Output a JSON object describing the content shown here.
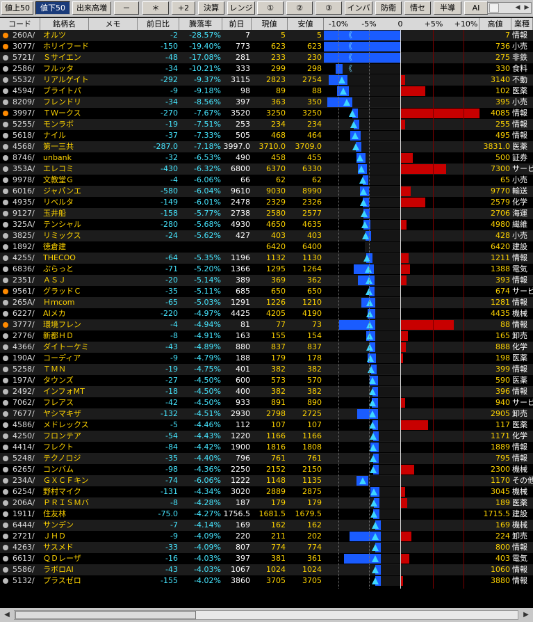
{
  "toolbar": {
    "buttons": [
      {
        "label": "値上50",
        "active": false
      },
      {
        "label": "値下50",
        "active": true
      },
      {
        "label": "出来高増",
        "active": false
      },
      {
        "label": "－",
        "active": false
      },
      {
        "label": "＊",
        "active": false
      },
      {
        "label": "+2",
        "active": false
      },
      {
        "label": "決算",
        "active": false
      },
      {
        "label": "レンジ",
        "active": false
      },
      {
        "label": "①",
        "active": false
      },
      {
        "label": "②",
        "active": false
      },
      {
        "label": "③",
        "active": false
      },
      {
        "label": "インバ",
        "active": false
      },
      {
        "label": "防衛",
        "active": false
      },
      {
        "label": "情セ",
        "active": false
      },
      {
        "label": "半導",
        "active": false
      },
      {
        "label": "AI",
        "active": false
      },
      {
        "label": "少",
        "active": false
      }
    ]
  },
  "header": {
    "code": "コード",
    "name": "銘柄名",
    "memo": "メモ",
    "chg": "前日比",
    "pct": "騰落率",
    "prev": "前日",
    "cur": "現値",
    "low": "安値",
    "scale": [
      "-10%",
      "-5%",
      "0",
      "+5%",
      "+10%"
    ],
    "high": "高値",
    "sector": "業種"
  },
  "colors": {
    "accent_blue": "#1a5cff",
    "red": "#c80000",
    "yellow_text": "#ffd400",
    "cyan_text": "#46e6ff"
  },
  "rows": [
    {
      "dot": "orange",
      "code": "260A/",
      "name": "オルツ",
      "chg": "-2",
      "pct": "-28.57%",
      "prev": "7",
      "cur": "5",
      "low": "5",
      "high": "7",
      "sector": "情報",
      "range": [
        -28.6,
        0
      ],
      "cur_pct": -28.6,
      "chev": true
    },
    {
      "dot": "orange",
      "code": "3077/",
      "name": "ホリイフード",
      "chg": "-150",
      "pct": "-19.40%",
      "prev": "773",
      "cur": "623",
      "low": "623",
      "high": "736",
      "sector": "小売",
      "range": [
        -19.4,
        -4.8
      ],
      "cur_pct": -19.4,
      "chev": true
    },
    {
      "dot": "gray",
      "code": "5721/",
      "name": "Ｓサイエン",
      "chg": "-48",
      "pct": "-17.08%",
      "prev": "281",
      "cur": "233",
      "low": "230",
      "high": "275",
      "sector": "非鉄",
      "range": [
        -18.1,
        -2.1
      ],
      "cur_pct": -17.1,
      "chev": true
    },
    {
      "dot": "gray",
      "code": "2586/",
      "name": "フルッタ",
      "chg": "-34",
      "pct": "-10.21%",
      "prev": "333",
      "cur": "299",
      "low": "298",
      "high": "330",
      "sector": "食料",
      "range": [
        -10.5,
        -0.9
      ],
      "cur_pct": -10.2,
      "chev": true
    },
    {
      "dot": "gray",
      "code": "5532/",
      "name": "リアルゲイト",
      "chg": "-292",
      "pct": "-9.37%",
      "prev": "3115",
      "cur": "2823",
      "low": "2754",
      "high": "3140",
      "sector": "不動",
      "range": [
        -11.6,
        0.8
      ],
      "cur_pct": -9.4,
      "chev": false
    },
    {
      "dot": "gray",
      "code": "4594/",
      "name": "ブライトパ",
      "chg": "-9",
      "pct": "-9.18%",
      "prev": "98",
      "cur": "89",
      "low": "88",
      "high": "102",
      "sector": "医薬",
      "range": [
        -10.2,
        4.1
      ],
      "cur_pct": -9.2,
      "chev": false
    },
    {
      "dot": "gray",
      "code": "8209/",
      "name": "フレンドリ",
      "chg": "-34",
      "pct": "-8.56%",
      "prev": "397",
      "cur": "363",
      "low": "350",
      "high": "395",
      "sector": "小売",
      "range": [
        -11.8,
        -0.5
      ],
      "cur_pct": -8.6,
      "chev": false
    },
    {
      "dot": "orange",
      "code": "3997/",
      "name": "ＴＷークス",
      "chg": "-270",
      "pct": "-7.67%",
      "prev": "3520",
      "cur": "3250",
      "low": "3250",
      "high": "4085",
      "sector": "情報",
      "range": [
        -7.7,
        16.1
      ],
      "cur_pct": -7.7,
      "chev": false
    },
    {
      "dot": "gray",
      "code": "5255/",
      "name": "モンラボ",
      "chg": "-19",
      "pct": "-7.51%",
      "prev": "253",
      "cur": "234",
      "low": "234",
      "high": "255",
      "sector": "情報",
      "range": [
        -7.5,
        0.8
      ],
      "cur_pct": -7.5,
      "chev": false
    },
    {
      "dot": "gray",
      "code": "5618/",
      "name": "ナイル",
      "chg": "-37",
      "pct": "-7.33%",
      "prev": "505",
      "cur": "468",
      "low": "464",
      "high": "495",
      "sector": "情報",
      "range": [
        -8.1,
        -2.0
      ],
      "cur_pct": -7.3,
      "chev": false
    },
    {
      "dot": "gray",
      "code": "4568/",
      "name": "第一三共",
      "chg": "-287.0",
      "pct": "-7.18%",
      "prev": "3997.0",
      "cur": "3710.0",
      "low": "3709.0",
      "high": "3831.0",
      "sector": "医薬",
      "range": [
        -7.2,
        -4.2
      ],
      "cur_pct": -7.2,
      "chev": false
    },
    {
      "dot": "gray",
      "code": "8746/",
      "name": "unbank",
      "chg": "-32",
      "pct": "-6.53%",
      "prev": "490",
      "cur": "458",
      "low": "455",
      "high": "500",
      "sector": "証券",
      "range": [
        -7.1,
        2.0
      ],
      "cur_pct": -6.5,
      "chev": false
    },
    {
      "dot": "gray",
      "code": "353A/",
      "name": "エレコミ",
      "chg": "-430",
      "pct": "-6.32%",
      "prev": "6800",
      "cur": "6370",
      "low": "6330",
      "high": "7300",
      "sector": "サービ",
      "range": [
        -6.9,
        7.4
      ],
      "cur_pct": -6.3,
      "chev": false
    },
    {
      "dot": "gray",
      "code": "9978/",
      "name": "文教堂Ｇ",
      "chg": "-4",
      "pct": "-6.06%",
      "prev": "66",
      "cur": "62",
      "low": "62",
      "high": "65",
      "sector": "小売",
      "range": [
        -6.1,
        -1.5
      ],
      "cur_pct": -6.1,
      "chev": false
    },
    {
      "dot": "gray",
      "code": "6016/",
      "name": "ジャパンエ",
      "chg": "-580",
      "pct": "-6.04%",
      "prev": "9610",
      "cur": "9030",
      "low": "8990",
      "high": "9770",
      "sector": "輸送",
      "range": [
        -6.5,
        1.7
      ],
      "cur_pct": -6.0,
      "chev": false
    },
    {
      "dot": "gray",
      "code": "4935/",
      "name": "リベルタ",
      "chg": "-149",
      "pct": "-6.01%",
      "prev": "2478",
      "cur": "2329",
      "low": "2326",
      "high": "2579",
      "sector": "化学",
      "range": [
        -6.1,
        4.1
      ],
      "cur_pct": -6.0,
      "chev": false
    },
    {
      "dot": "gray",
      "code": "9127/",
      "name": "玉井船",
      "chg": "-158",
      "pct": "-5.77%",
      "prev": "2738",
      "cur": "2580",
      "low": "2577",
      "high": "2706",
      "sector": "海運",
      "range": [
        -5.9,
        -1.2
      ],
      "cur_pct": -5.8,
      "chev": false
    },
    {
      "dot": "gray",
      "code": "325A/",
      "name": "テンシャル",
      "chg": "-280",
      "pct": "-5.68%",
      "prev": "4930",
      "cur": "4650",
      "low": "4635",
      "high": "4980",
      "sector": "繊維",
      "range": [
        -6.0,
        1.0
      ],
      "cur_pct": -5.7,
      "chev": false
    },
    {
      "dot": "gray",
      "code": "3825/",
      "name": "リミックス",
      "chg": "-24",
      "pct": "-5.62%",
      "prev": "427",
      "cur": "403",
      "low": "403",
      "high": "428",
      "sector": "小売",
      "range": [
        -5.6,
        0.2
      ],
      "cur_pct": -5.6,
      "chev": false
    },
    {
      "dot": "gray",
      "code": "1892/",
      "name": "徳倉建",
      "chg": "",
      "pct": "",
      "prev": "",
      "cur": "6420",
      "low": "6400",
      "high": "6420",
      "sector": "建設",
      "range": [
        -5.7,
        0
      ],
      "cur_pct": -5.5,
      "chev": false,
      "noBlue": true
    },
    {
      "dot": "gray",
      "code": "4255/",
      "name": "THECOO",
      "chg": "-64",
      "pct": "-5.35%",
      "prev": "1196",
      "cur": "1132",
      "low": "1130",
      "high": "1211",
      "sector": "情報",
      "range": [
        -5.5,
        1.3
      ],
      "cur_pct": -5.4,
      "chev": false
    },
    {
      "dot": "gray",
      "code": "6836/",
      "name": "ぷらっと",
      "chg": "-71",
      "pct": "-5.20%",
      "prev": "1366",
      "cur": "1295",
      "low": "1264",
      "high": "1388",
      "sector": "電気",
      "range": [
        -7.5,
        1.6
      ],
      "cur_pct": -5.2,
      "chev": false
    },
    {
      "dot": "gray",
      "code": "2351/",
      "name": "ＡＳＪ",
      "chg": "-20",
      "pct": "-5.14%",
      "prev": "389",
      "cur": "369",
      "low": "362",
      "high": "393",
      "sector": "情報",
      "range": [
        -6.9,
        1.0
      ],
      "cur_pct": -5.1,
      "chev": false
    },
    {
      "dot": "orange",
      "code": "9561/",
      "name": "グラッドＣ",
      "chg": "-35",
      "pct": "-5.11%",
      "prev": "685",
      "cur": "650",
      "low": "650",
      "high": "674",
      "sector": "サービ",
      "range": [
        -5.1,
        -1.6
      ],
      "cur_pct": -5.1,
      "chev": false
    },
    {
      "dot": "gray",
      "code": "265A/",
      "name": "Ｈｍcom",
      "chg": "-65",
      "pct": "-5.03%",
      "prev": "1291",
      "cur": "1226",
      "low": "1210",
      "high": "1281",
      "sector": "情報",
      "range": [
        -6.3,
        -0.8
      ],
      "cur_pct": -5.0,
      "chev": false
    },
    {
      "dot": "gray",
      "code": "6227/",
      "name": "AIメカ",
      "chg": "-220",
      "pct": "-4.97%",
      "prev": "4425",
      "cur": "4205",
      "low": "4190",
      "high": "4435",
      "sector": "機械",
      "range": [
        -5.3,
        0.2
      ],
      "cur_pct": -5.0,
      "chev": false
    },
    {
      "dot": "orange",
      "code": "3777/",
      "name": "環境フレン",
      "chg": "-4",
      "pct": "-4.94%",
      "prev": "81",
      "cur": "77",
      "low": "73",
      "high": "88",
      "sector": "情報",
      "range": [
        -9.9,
        8.6
      ],
      "cur_pct": -4.9,
      "chev": false
    },
    {
      "dot": "gray",
      "code": "2776/",
      "name": "新都ＨＤ",
      "chg": "-8",
      "pct": "-4.91%",
      "prev": "163",
      "cur": "155",
      "low": "154",
      "high": "165",
      "sector": "卸売",
      "range": [
        -5.5,
        1.2
      ],
      "cur_pct": -4.9,
      "chev": false
    },
    {
      "dot": "gray",
      "code": "4366/",
      "name": "ダイトーケミ",
      "chg": "-43",
      "pct": "-4.89%",
      "prev": "880",
      "cur": "837",
      "low": "837",
      "high": "888",
      "sector": "化学",
      "range": [
        -4.9,
        0.9
      ],
      "cur_pct": -4.9,
      "chev": false
    },
    {
      "dot": "gray",
      "code": "190A/",
      "name": "コーディア",
      "chg": "-9",
      "pct": "-4.79%",
      "prev": "188",
      "cur": "179",
      "low": "178",
      "high": "198",
      "sector": "医薬",
      "range": [
        -5.3,
        0.5
      ],
      "cur_pct": -4.8,
      "chev": false
    },
    {
      "dot": "gray",
      "code": "5258/",
      "name": "ＴＭＮ",
      "chg": "-19",
      "pct": "-4.75%",
      "prev": "401",
      "cur": "382",
      "low": "382",
      "high": "399",
      "sector": "情報",
      "range": [
        -4.7,
        -0.5
      ],
      "cur_pct": -4.7,
      "chev": false
    },
    {
      "dot": "gray",
      "code": "197A/",
      "name": "タウンズ",
      "chg": "-27",
      "pct": "-4.50%",
      "prev": "600",
      "cur": "573",
      "low": "570",
      "high": "590",
      "sector": "医薬",
      "range": [
        -5.0,
        -0.2
      ],
      "cur_pct": -4.5,
      "chev": false
    },
    {
      "dot": "gray",
      "code": "2492/",
      "name": "インフォMT",
      "chg": "-18",
      "pct": "-4.50%",
      "prev": "400",
      "cur": "382",
      "low": "382",
      "high": "396",
      "sector": "情報",
      "range": [
        -4.5,
        -1.0
      ],
      "cur_pct": -4.5,
      "chev": false
    },
    {
      "dot": "gray",
      "code": "7062/",
      "name": "フレアス",
      "chg": "-42",
      "pct": "-4.50%",
      "prev": "933",
      "cur": "891",
      "low": "890",
      "high": "940",
      "sector": "サービ",
      "range": [
        -4.6,
        0.8
      ],
      "cur_pct": -4.5,
      "chev": false
    },
    {
      "dot": "gray",
      "code": "7677/",
      "name": "ヤシマキザ",
      "chg": "-132",
      "pct": "-4.51%",
      "prev": "2930",
      "cur": "2798",
      "low": "2725",
      "high": "2905",
      "sector": "卸売",
      "range": [
        -7.0,
        -0.9
      ],
      "cur_pct": -4.5,
      "chev": false
    },
    {
      "dot": "gray",
      "code": "4586/",
      "name": "メドレックス",
      "chg": "-5",
      "pct": "-4.46%",
      "prev": "112",
      "cur": "107",
      "low": "107",
      "high": "117",
      "sector": "医薬",
      "range": [
        -4.5,
        4.5
      ],
      "cur_pct": -4.5,
      "chev": false
    },
    {
      "dot": "gray",
      "code": "4250/",
      "name": "フロンテア",
      "chg": "-54",
      "pct": "-4.43%",
      "prev": "1220",
      "cur": "1166",
      "low": "1166",
      "high": "1171",
      "sector": "化学",
      "range": [
        -4.4,
        -4.0
      ],
      "cur_pct": -4.4,
      "chev": false
    },
    {
      "dot": "gray",
      "code": "4414/",
      "name": "フレクト",
      "chg": "-84",
      "pct": "-4.42%",
      "prev": "1900",
      "cur": "1816",
      "low": "1808",
      "high": "1889",
      "sector": "情報",
      "range": [
        -4.8,
        -0.6
      ],
      "cur_pct": -4.4,
      "chev": false
    },
    {
      "dot": "gray",
      "code": "5248/",
      "name": "テクノロジ",
      "chg": "-35",
      "pct": "-4.40%",
      "prev": "796",
      "cur": "761",
      "low": "761",
      "high": "795",
      "sector": "情報",
      "range": [
        -4.4,
        -0.1
      ],
      "cur_pct": -4.4,
      "chev": false
    },
    {
      "dot": "gray",
      "code": "6265/",
      "name": "コンバム",
      "chg": "-98",
      "pct": "-4.36%",
      "prev": "2250",
      "cur": "2152",
      "low": "2150",
      "high": "2300",
      "sector": "機械",
      "range": [
        -4.4,
        2.2
      ],
      "cur_pct": -4.4,
      "chev": false
    },
    {
      "dot": "gray",
      "code": "234A/",
      "name": "ＧＸＣＦキン",
      "chg": "-74",
      "pct": "-6.06%",
      "prev": "1222",
      "cur": "1148",
      "low": "1135",
      "high": "1170",
      "sector": "その他",
      "range": [
        -7.1,
        -4.3
      ],
      "cur_pct": -6.1,
      "chev": false
    },
    {
      "dot": "gray",
      "code": "6254/",
      "name": "野村マイク",
      "chg": "-131",
      "pct": "-4.34%",
      "prev": "3020",
      "cur": "2889",
      "low": "2875",
      "high": "3045",
      "sector": "機械",
      "range": [
        -4.8,
        0.8
      ],
      "cur_pct": -4.3,
      "chev": false
    },
    {
      "dot": "gray",
      "code": "206A/",
      "name": "ＰＲＩＳＭバ",
      "chg": "-8",
      "pct": "-4.28%",
      "prev": "187",
      "cur": "179",
      "low": "179",
      "high": "189",
      "sector": "医薬",
      "range": [
        -4.3,
        1.1
      ],
      "cur_pct": -4.3,
      "chev": false
    },
    {
      "dot": "gray",
      "code": "1911/",
      "name": "住友林",
      "chg": "-75.0",
      "pct": "-4.27%",
      "prev": "1756.5",
      "cur": "1681.5",
      "low": "1679.5",
      "high": "1715.5",
      "sector": "建設",
      "range": [
        -4.4,
        -2.3
      ],
      "cur_pct": -4.3,
      "chev": false
    },
    {
      "dot": "gray",
      "code": "6444/",
      "name": "サンデン",
      "chg": "-7",
      "pct": "-4.14%",
      "prev": "169",
      "cur": "162",
      "low": "162",
      "high": "169",
      "sector": "機械",
      "range": [
        -4.1,
        0
      ],
      "cur_pct": -4.1,
      "chev": false
    },
    {
      "dot": "gray",
      "code": "2721/",
      "name": "ＪＨＤ",
      "chg": "-9",
      "pct": "-4.09%",
      "prev": "220",
      "cur": "211",
      "low": "202",
      "high": "224",
      "sector": "卸売",
      "range": [
        -8.2,
        1.8
      ],
      "cur_pct": -4.1,
      "chev": false
    },
    {
      "dot": "gray",
      "code": "4263/",
      "name": "サスメド",
      "chg": "-33",
      "pct": "-4.09%",
      "prev": "807",
      "cur": "774",
      "low": "774",
      "high": "800",
      "sector": "情報",
      "range": [
        -4.1,
        -0.9
      ],
      "cur_pct": -4.1,
      "chev": false
    },
    {
      "dot": "gray",
      "code": "6613/",
      "name": "ＱＤレーザ",
      "chg": "-16",
      "pct": "-4.03%",
      "prev": "397",
      "cur": "381",
      "low": "361",
      "high": "403",
      "sector": "電気",
      "range": [
        -9.1,
        1.5
      ],
      "cur_pct": -4.0,
      "chev": false
    },
    {
      "dot": "gray",
      "code": "5586/",
      "name": "ラボロAI",
      "chg": "-43",
      "pct": "-4.03%",
      "prev": "1067",
      "cur": "1024",
      "low": "1024",
      "high": "1060",
      "sector": "情報",
      "range": [
        -4.0,
        -0.7
      ],
      "cur_pct": -4.0,
      "chev": false
    },
    {
      "dot": "gray",
      "code": "5132/",
      "name": "プラスゼロ",
      "chg": "-155",
      "pct": "-4.02%",
      "prev": "3860",
      "cur": "3705",
      "low": "3705",
      "high": "3880",
      "sector": "情報",
      "range": [
        -4.0,
        0.5
      ],
      "cur_pct": -4.0,
      "chev": false
    }
  ]
}
